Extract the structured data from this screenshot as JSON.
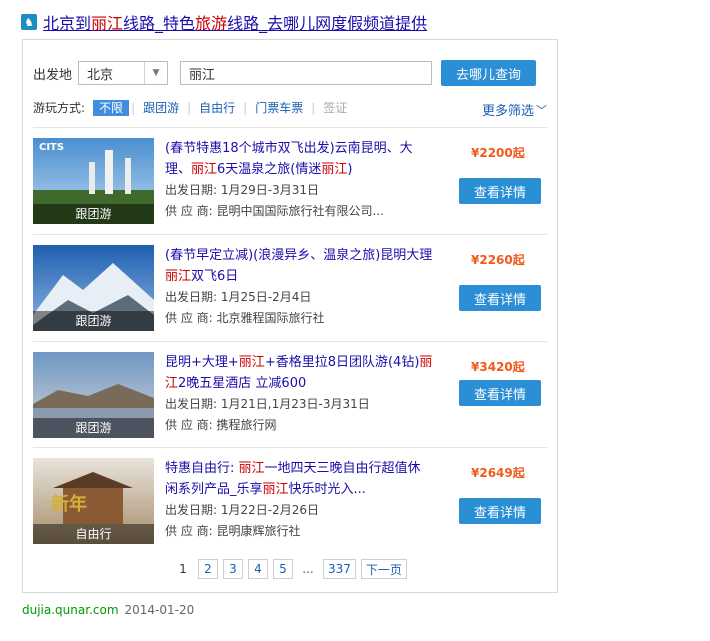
{
  "header": {
    "title_parts": [
      "北京到",
      "丽江",
      "线路_特色",
      "旅游",
      "线路_去哪儿网度假频道提供"
    ],
    "icon": "camel-icon"
  },
  "search": {
    "from_label": "出发地",
    "from_value": "北京",
    "dest_value": "丽江",
    "button_label": "去哪儿查询"
  },
  "filters": {
    "label": "游玩方式:",
    "tabs": [
      "不限",
      "跟团游",
      "自由行",
      "门票车票",
      "签证"
    ],
    "more_label": "更多筛选"
  },
  "products": [
    {
      "name_parts": [
        "(春节特惠18个城市双飞出发)云南昆明、大理、",
        "丽江",
        "6天温泉之旅(情迷",
        "丽江",
        ")"
      ],
      "date_label": "出发日期:",
      "date": "1月29日-3月31日",
      "supplier_label": "供 应 商:",
      "supplier": "昆明中国国际旅行社有限公司...",
      "price": "¥2200起",
      "type": "跟团游",
      "button": "查看详情",
      "thumb_text": "CITS"
    },
    {
      "name_parts": [
        "(春节早定立减)(浪漫异乡、温泉之旅)昆明大理",
        "丽江",
        "双飞6日"
      ],
      "date_label": "出发日期:",
      "date": "1月25日-2月4日",
      "supplier_label": "供 应 商:",
      "supplier": "北京雅程国际旅行社",
      "price": "¥2260起",
      "type": "跟团游",
      "button": "查看详情"
    },
    {
      "name_parts": [
        "昆明+大理+",
        "丽江",
        "+香格里拉8日团队游(4钻)",
        "丽江",
        "2晚五星酒店 立减600"
      ],
      "date_label": "出发日期:",
      "date": "1月21日,1月23日-3月31日",
      "supplier_label": "供 应 商:",
      "supplier": "携程旅行网",
      "price": "¥3420起",
      "type": "跟团游",
      "button": "查看详情"
    },
    {
      "name_parts": [
        "特惠自由行: ",
        "丽江",
        "一地四天三晚自由行超值休闲系列产品_乐享",
        "丽江",
        "快乐时光入..."
      ],
      "date_label": "出发日期:",
      "date": "1月22日-2月26日",
      "supplier_label": "供 应 商:",
      "supplier": "昆明康辉旅行社",
      "price": "¥2649起",
      "type": "自由行",
      "button": "查看详情"
    }
  ],
  "pagination": {
    "current": "1",
    "pages": [
      "2",
      "3",
      "4",
      "5"
    ],
    "ellipsis": "...",
    "last": "337",
    "next_label": "下一页"
  },
  "source": {
    "domain": "dujia.qunar.com",
    "date": "2014-01-20"
  },
  "colors": {
    "accent": "#2b8fd6",
    "price": "#f25a1d",
    "link": "#1a0dab",
    "highlight": "#cc0000"
  }
}
